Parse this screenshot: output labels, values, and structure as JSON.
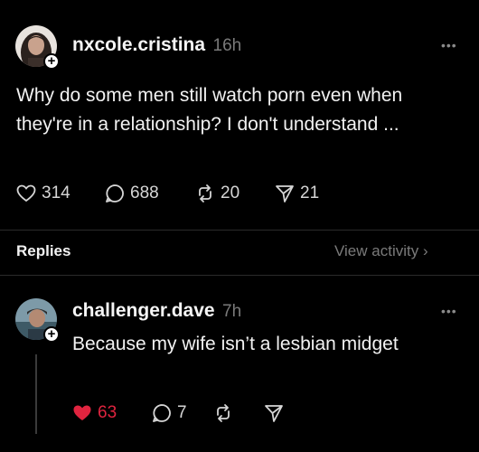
{
  "post": {
    "username": "nxcole.cristina",
    "time": "16h",
    "more_icon": "more-icon",
    "text": "Why do some men still watch porn even when they're in a relationship? I don't understand ...",
    "stats": {
      "likes": "314",
      "comments": "688",
      "reposts": "20",
      "shares": "21"
    }
  },
  "replies_section": {
    "title": "Replies",
    "view_activity": "View activity ›"
  },
  "reply": {
    "username": "challenger.dave",
    "time": "7h",
    "more_icon": "more-icon",
    "text": "Because my wife isn’t a lesbian midget",
    "stats": {
      "likes": "63",
      "comments": "7"
    },
    "like_color": "#e0243f"
  }
}
